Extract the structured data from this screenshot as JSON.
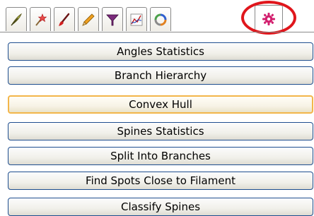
{
  "tabs": [
    {
      "icon": "feather-pen-icon"
    },
    {
      "icon": "magic-wand-icon"
    },
    {
      "icon": "brush-icon"
    },
    {
      "icon": "pencil-icon"
    },
    {
      "icon": "funnel-filter-icon"
    },
    {
      "icon": "chart-icon"
    },
    {
      "icon": "cycle-arrows-icon"
    },
    {
      "icon": "gear-icon",
      "active": true
    }
  ],
  "buttons": [
    {
      "label": "Angles Statistics"
    },
    {
      "label": "Branch Hierarchy"
    },
    {
      "label": "Convex Hull",
      "focused": true
    },
    {
      "label": "Spines Statistics"
    },
    {
      "label": "Split Into Branches"
    },
    {
      "label": "Find Spots Close to Filament"
    },
    {
      "label": "Classify Spines"
    }
  ],
  "colors": {
    "highlight": "#e0161c",
    "button_border": "#1e4e8f",
    "focus_border": "#f3b64a"
  }
}
